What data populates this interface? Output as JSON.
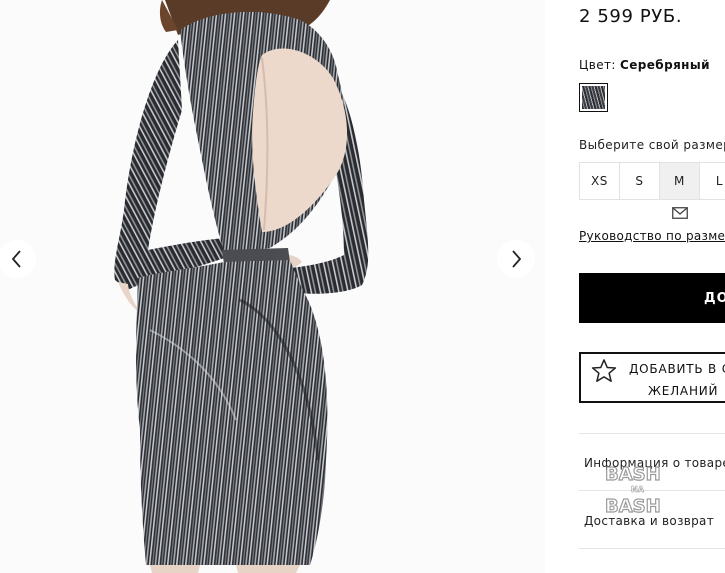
{
  "product": {
    "price": "2 599 РУБ.",
    "color_label": "Цвет:",
    "color_value": "Серебряный",
    "color_swatch_hex": "#4a4c52",
    "size_label": "Выберите свой размер:",
    "sizes": [
      "XS",
      "S",
      "M",
      "L"
    ],
    "selected_size": "M",
    "size_guide": "Руководство по размерам",
    "add_to_cart": "ДОБАВИТЬ",
    "wishlist_line1": "ДОБАВИТЬ В СПИСОК",
    "wishlist_line2": "ЖЕЛАНИЙ"
  },
  "accordion": {
    "info": "Информация о товаре",
    "delivery": "Доставка и возврат"
  },
  "gallery": {
    "prev_icon": "chevron-left-icon",
    "next_icon": "chevron-right-icon"
  },
  "watermark_text": "BASH NA BASH",
  "colors": {
    "button_bg": "#000000",
    "divider": "#e4e4e4",
    "selected_size_bg": "#f0f0f0"
  }
}
